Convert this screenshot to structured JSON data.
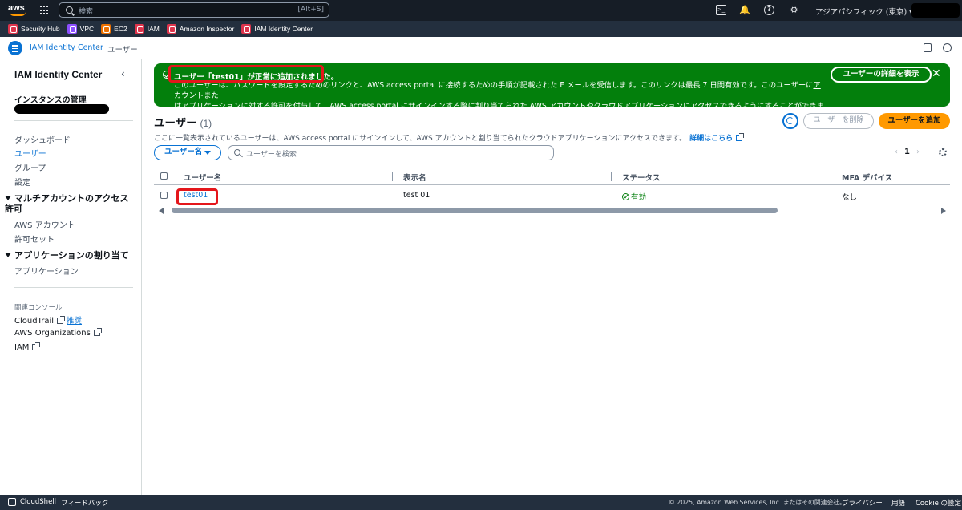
{
  "topnav": {
    "logo": "aws",
    "search_placeholder": "検索",
    "search_shortcut": "[Alt+S]",
    "region": "アジアパシフィック (東京) ▾",
    "icons": [
      "cloudshell-icon",
      "bell-icon",
      "help-icon",
      "gear-icon"
    ]
  },
  "favorites": [
    {
      "label": "Security Hub",
      "color": "#dd344c"
    },
    {
      "label": "VPC",
      "color": "#8c4fff"
    },
    {
      "label": "EC2",
      "color": "#ed7100"
    },
    {
      "label": "IAM",
      "color": "#dd344c"
    },
    {
      "label": "Amazon Inspector",
      "color": "#dd344c"
    },
    {
      "label": "IAM Identity Center",
      "color": "#dd344c"
    }
  ],
  "breadcrumb": {
    "root": "IAM Identity Center",
    "separator": "›",
    "current": "ユーザー"
  },
  "sidebar": {
    "title": "IAM Identity Center",
    "instance_heading": "インスタンスの管理",
    "items": [
      {
        "label": "ダッシュボード",
        "active": false
      },
      {
        "label": "ユーザー",
        "active": true
      },
      {
        "label": "グループ",
        "active": false
      },
      {
        "label": "設定",
        "active": false
      }
    ],
    "section_multi": "マルチアカウントのアクセス許可",
    "multi_items": [
      "AWS アカウント",
      "許可セット"
    ],
    "section_app": "アプリケーションの割り当て",
    "app_items": [
      "アプリケーション"
    ],
    "related_heading": "関連コンソール",
    "related": [
      {
        "label": "CloudTrail",
        "sub": "推奨"
      },
      {
        "label": "AWS Organizations"
      },
      {
        "label": "IAM"
      }
    ]
  },
  "flash": {
    "title": "ユーザー「test01」が正常に追加されました。",
    "body_1": "このユーザーは、パスワードを設定するためのリンクと、AWS access portal に接続するための手順が記載された E メールを受信します。このリンクは最長 7 日間有効です。このユーザーに",
    "link_account": "アカウント",
    "body_2": "また",
    "body_3": "は",
    "link_app": "アプリケーション",
    "body_4": "に対する許可を付与して、AWS access portal にサインインする際に割り当てられた AWS アカウントやクラウドアプリケーションにアクセスできるようにすることができます。",
    "button": "ユーザーの詳細を表示",
    "color": "#037f0c"
  },
  "users": {
    "heading": "ユーザー",
    "count": "(1)",
    "description": "ここに一覧表示されているユーザーは、AWS access portal にサインインして、AWS アカウントと割り当てられたクラウドアプリケーションにアクセスできます。",
    "learn_more": "詳細はこちら",
    "delete_button": "ユーザーを削除",
    "add_button": "ユーザーを追加",
    "filter_property": "ユーザー名",
    "search_placeholder": "ユーザーを検索",
    "page_prev": "‹",
    "page_number": "1",
    "page_next": "›",
    "columns": [
      "ユーザー名",
      "表示名",
      "ステータス",
      "MFA デバイス"
    ],
    "rows": [
      {
        "username": "test01",
        "display_name": "test 01",
        "status": "有効",
        "mfa": "なし"
      }
    ]
  },
  "footer": {
    "cloudshell": "CloudShell",
    "feedback": "フィードバック",
    "copyright": "© 2025, Amazon Web Services, Inc. またはその関連会社。",
    "privacy": "プライバシー",
    "terms": "用語",
    "cookies": "Cookie の設定"
  }
}
